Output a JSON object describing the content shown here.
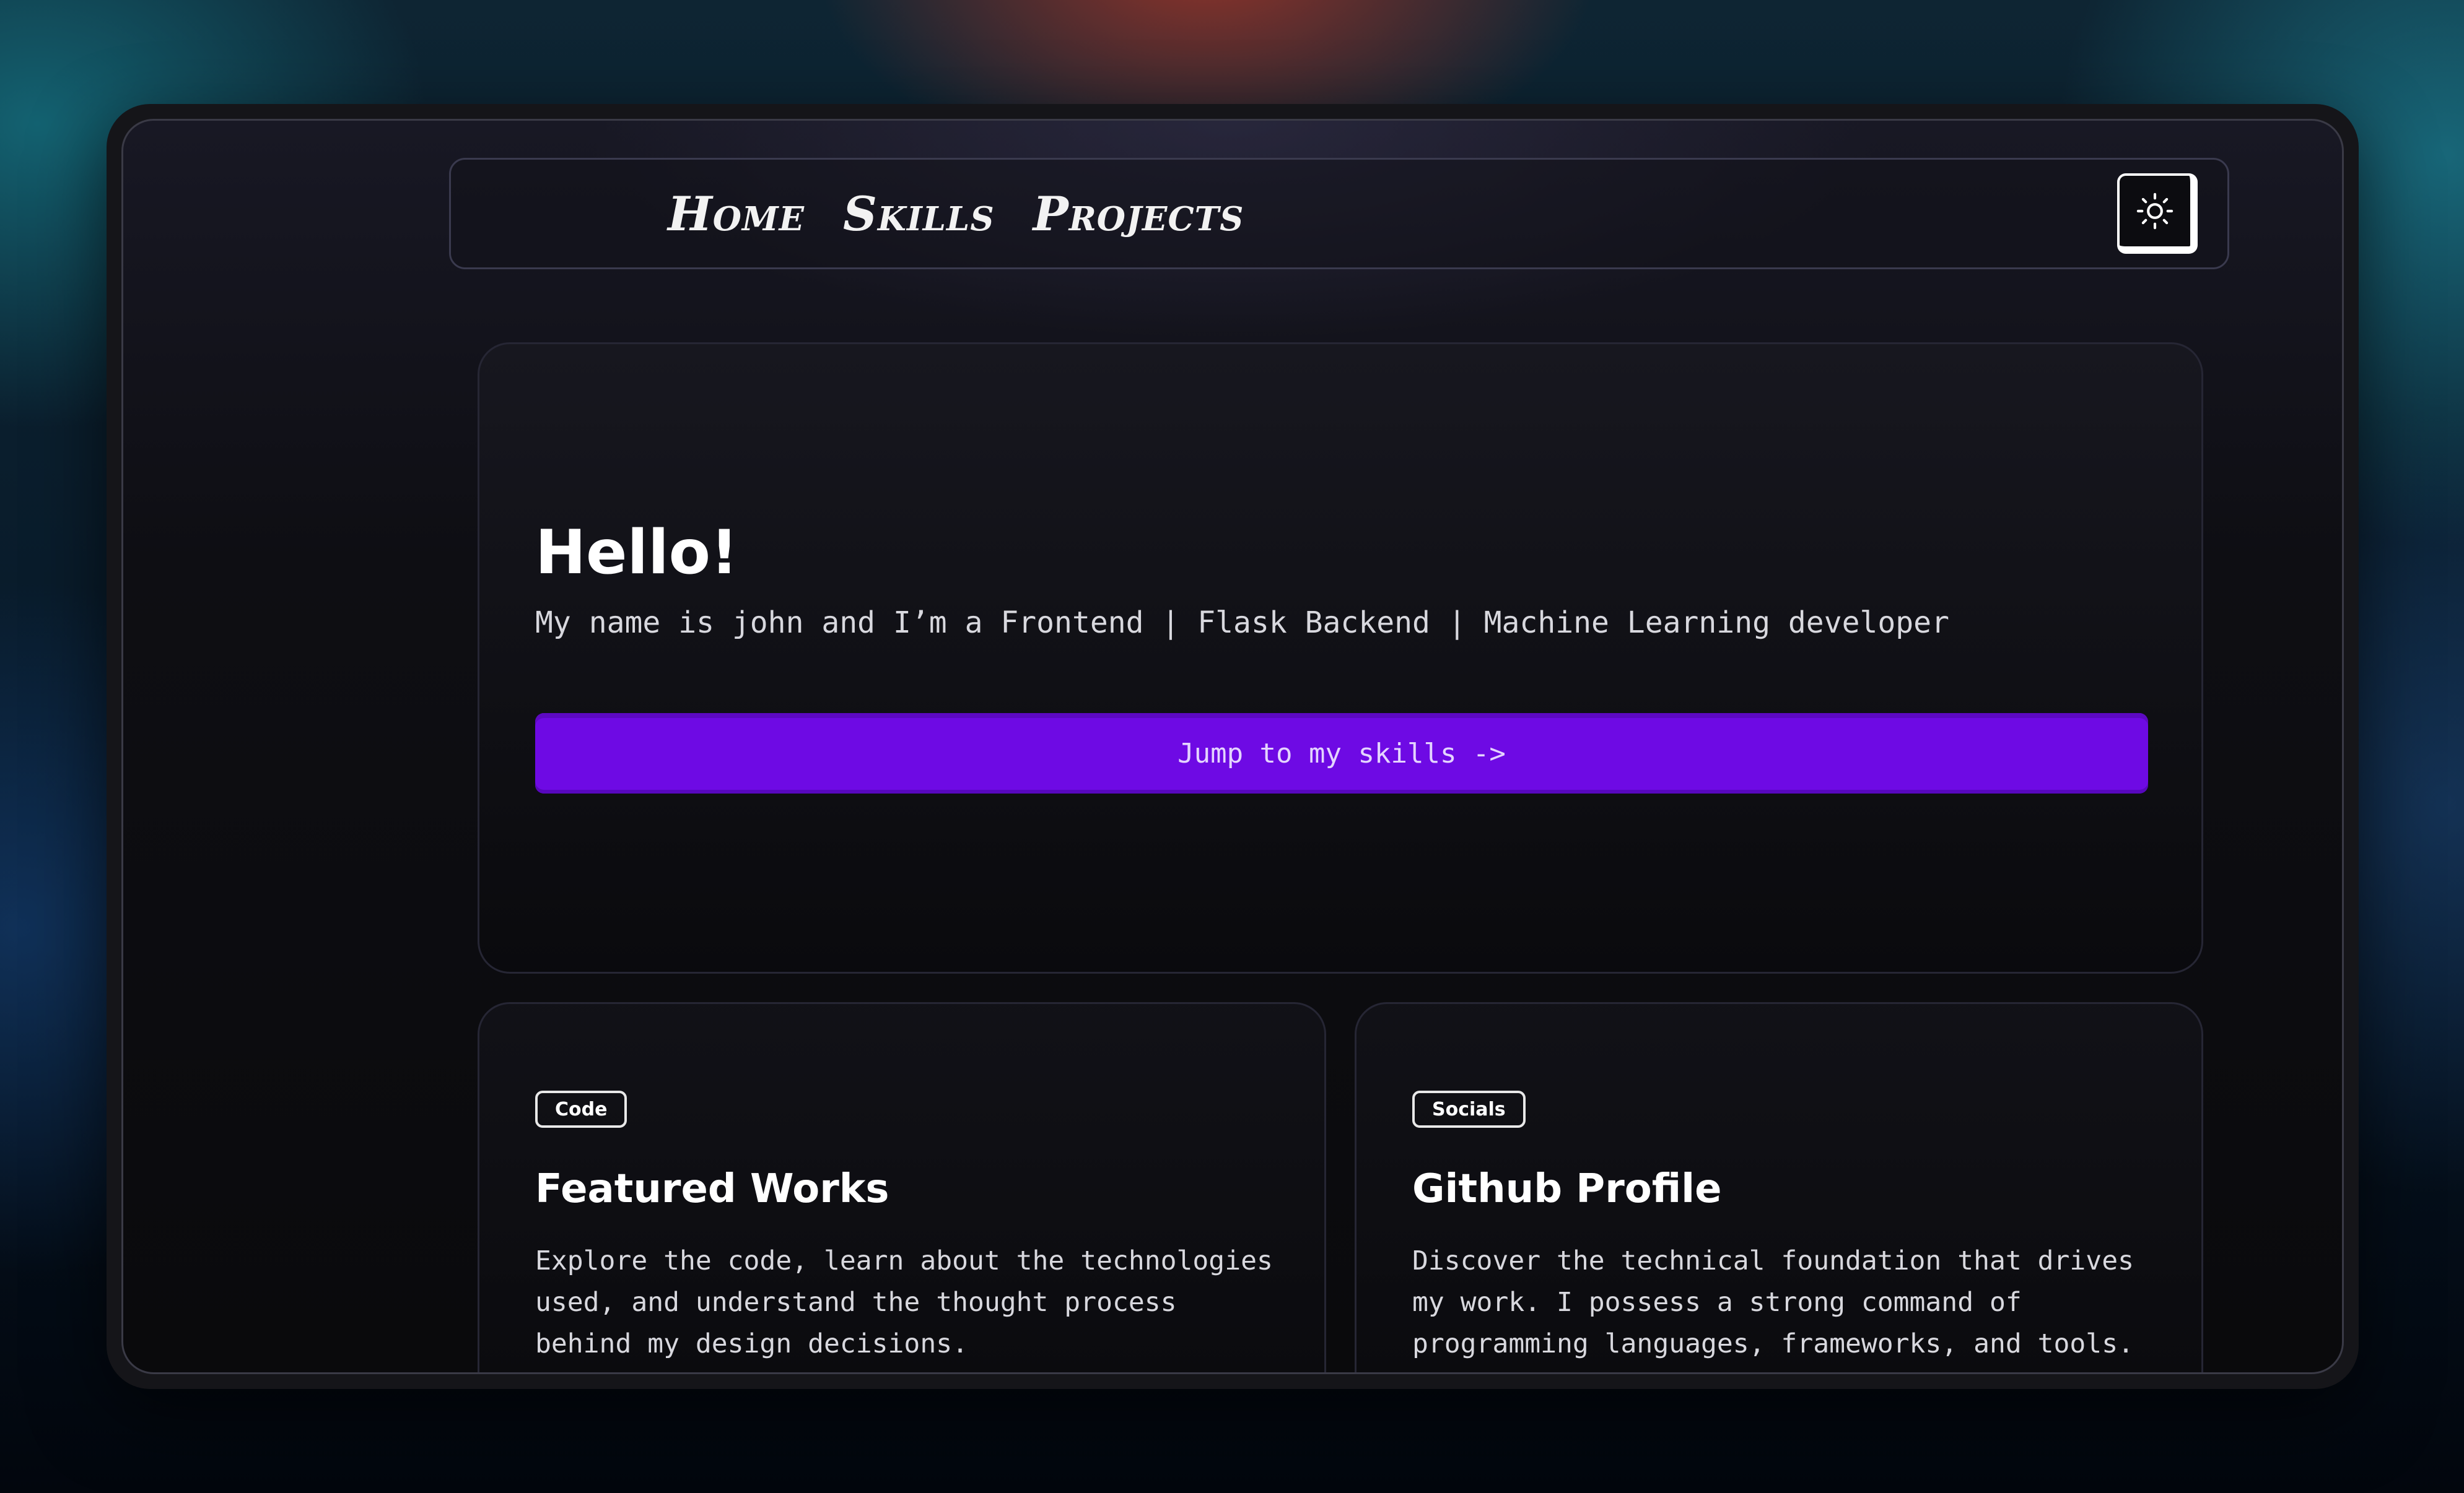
{
  "nav": {
    "links": [
      "Home",
      "Skills",
      "Projects"
    ],
    "theme_toggle_icon": "sun-icon"
  },
  "hero": {
    "title": "Hello!",
    "subtitle": "My name is john and I’m a Frontend | Flask Backend | Machine Learning developer",
    "cta_label": "Jump to my skills ->"
  },
  "cards": [
    {
      "badge": "Code",
      "title": "Featured Works",
      "text": "Explore the code, learn about the technologies used, and understand the thought process behind my design decisions."
    },
    {
      "badge": "Socials",
      "title": "Github Profile",
      "text": "Discover the technical foundation that drives my work. I possess a strong command of programming languages, frameworks, and tools."
    }
  ],
  "colors": {
    "accent": "#6e0ae4",
    "background": "#0a0a0c",
    "text": "#ffffff"
  }
}
